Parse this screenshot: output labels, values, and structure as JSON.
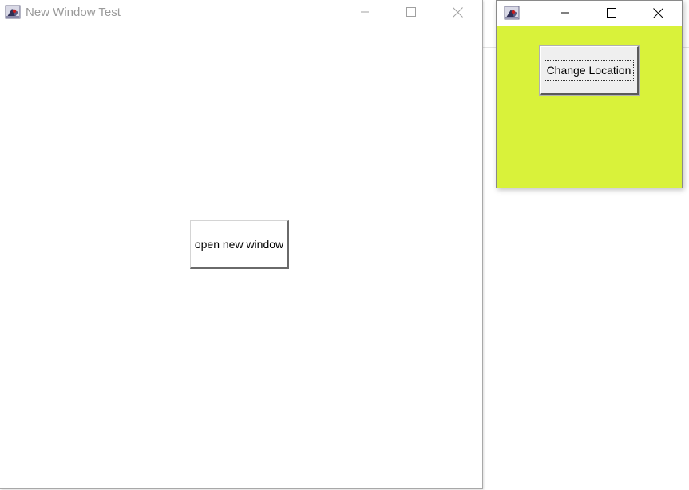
{
  "main_window": {
    "title": "New Window Test",
    "button_label": "open new window"
  },
  "secondary_window": {
    "title": "",
    "button_label": "Change Location",
    "background_color": "#d9f23a"
  },
  "icons": {
    "app": "java-app-icon",
    "minimize": "minimize-icon",
    "maximize": "maximize-icon",
    "close": "close-icon"
  }
}
